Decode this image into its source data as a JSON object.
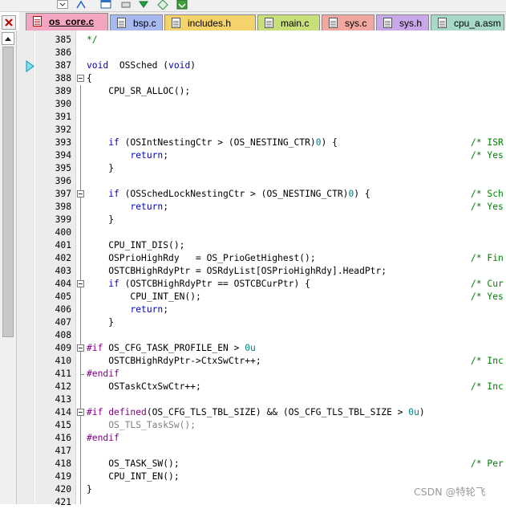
{
  "tabs": [
    {
      "label": "os_core.c",
      "active": true,
      "color": "#f4a6c0"
    },
    {
      "label": "bsp.c",
      "active": false,
      "color": "#a8b8f0"
    },
    {
      "label": "includes.h",
      "active": false,
      "color": "#f4d36a"
    },
    {
      "label": "main.c",
      "active": false,
      "color": "#c8e07a"
    },
    {
      "label": "sys.c",
      "active": false,
      "color": "#f0a8a0"
    },
    {
      "label": "sys.h",
      "active": false,
      "color": "#c8a8e8"
    },
    {
      "label": "cpu_a.asm",
      "active": false,
      "color": "#a8d8c8"
    },
    {
      "label": "",
      "active": false,
      "color": "#e8e8e8"
    }
  ],
  "lines": [
    {
      "n": "385",
      "code": "*/",
      "cls": "cm"
    },
    {
      "n": "386",
      "code": ""
    },
    {
      "n": "387",
      "code": "void  OSSched (void)",
      "cls": "kw"
    },
    {
      "n": "388",
      "code": "{"
    },
    {
      "n": "389",
      "code": "    CPU_SR_ALLOC();"
    },
    {
      "n": "390",
      "code": ""
    },
    {
      "n": "391",
      "code": ""
    },
    {
      "n": "392",
      "code": ""
    },
    {
      "n": "393",
      "code": "    if (OSIntNestingCtr > (OS_NESTING_CTR)0) {",
      "cmt": "/* ISR"
    },
    {
      "n": "394",
      "code": "        return;",
      "cmt": "/* Yes"
    },
    {
      "n": "395",
      "code": "    }"
    },
    {
      "n": "396",
      "code": ""
    },
    {
      "n": "397",
      "code": "    if (OSSchedLockNestingCtr > (OS_NESTING_CTR)0) {",
      "cmt": "/* Sch"
    },
    {
      "n": "398",
      "code": "        return;",
      "cmt": "/* Yes"
    },
    {
      "n": "399",
      "code": "    }"
    },
    {
      "n": "400",
      "code": ""
    },
    {
      "n": "401",
      "code": "    CPU_INT_DIS();"
    },
    {
      "n": "402",
      "code": "    OSPrioHighRdy   = OS_PrioGetHighest();",
      "cmt": "/* Fin"
    },
    {
      "n": "403",
      "code": "    OSTCBHighRdyPtr = OSRdyList[OSPrioHighRdy].HeadPtr;"
    },
    {
      "n": "404",
      "code": "    if (OSTCBHighRdyPtr == OSTCBCurPtr) {",
      "cmt": "/* Cur"
    },
    {
      "n": "405",
      "code": "        CPU_INT_EN();",
      "cmt": "/* Yes"
    },
    {
      "n": "406",
      "code": "        return;"
    },
    {
      "n": "407",
      "code": "    }"
    },
    {
      "n": "408",
      "code": ""
    },
    {
      "n": "409",
      "code": "#if OS_CFG_TASK_PROFILE_EN > 0u"
    },
    {
      "n": "410",
      "code": "    OSTCBHighRdyPtr->CtxSwCtr++;",
      "cmt": "/* Inc"
    },
    {
      "n": "411",
      "code": "#endif"
    },
    {
      "n": "412",
      "code": "    OSTaskCtxSwCtr++;",
      "cmt": "/* Inc"
    },
    {
      "n": "413",
      "code": ""
    },
    {
      "n": "414",
      "code": "#if defined(OS_CFG_TLS_TBL_SIZE) && (OS_CFG_TLS_TBL_SIZE > 0u)"
    },
    {
      "n": "415",
      "code": "    OS_TLS_TaskSw();"
    },
    {
      "n": "416",
      "code": "#endif"
    },
    {
      "n": "417",
      "code": ""
    },
    {
      "n": "418",
      "code": "    OS_TASK_SW();",
      "cmt": "/* Per"
    },
    {
      "n": "419",
      "code": "    CPU_INT_EN();"
    },
    {
      "n": "420",
      "code": "}"
    },
    {
      "n": "421",
      "code": ""
    }
  ],
  "watermark": "CSDN @特轮飞"
}
